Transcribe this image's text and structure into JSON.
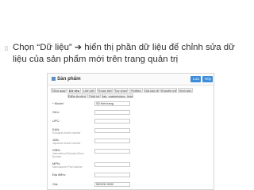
{
  "caption": {
    "part1": "Chọn “Dữ liệu” ",
    "arrow": "➔",
    "part2": " hiển thị phần dữ liệu để chỉnh sửa dữ liệu của sản phẩm mới trên trang quản trị"
  },
  "panel": {
    "title": "Sản phẩm",
    "save_label": "Lưu",
    "cancel_label": "Hủy"
  },
  "tabs": [
    {
      "label": "Tổng quan",
      "active": false
    },
    {
      "label": "Dữ liệu",
      "active": true
    },
    {
      "label": "Liên kết",
      "active": false
    },
    {
      "label": "Thuộc tính",
      "active": false
    },
    {
      "label": "Tùy chọn",
      "active": false
    },
    {
      "label": "Profiles",
      "active": false
    },
    {
      "label": "Giá bán lẻ",
      "active": false
    },
    {
      "label": "Khuyến mãi",
      "active": false
    },
    {
      "label": "Hình ảnh",
      "active": false
    },
    {
      "label": "Điểm thưởng",
      "active": false
    },
    {
      "label": "Thiết kế",
      "active": false
    },
    {
      "label": "tab_marketplace_links",
      "active": false
    }
  ],
  "fields": [
    {
      "label": "* Model:",
      "hint": "",
      "value": "Sổ thời trang"
    },
    {
      "label": "SKU:",
      "hint": "",
      "value": ""
    },
    {
      "label": "UPC:",
      "hint": "",
      "value": ""
    },
    {
      "label": "EAN:",
      "hint": "European Article Number",
      "value": ""
    },
    {
      "label": "JAN:",
      "hint": "Japanese Article Number",
      "value": ""
    },
    {
      "label": "ISBN:",
      "hint": "International Standard Book Number",
      "value": ""
    },
    {
      "label": "MPN:",
      "hint": "Manufacturer Part Number",
      "value": ""
    },
    {
      "label": "Địa điểm:",
      "hint": "",
      "value": ""
    },
    {
      "label": "Giá:",
      "hint": "",
      "value": "500000.0000"
    }
  ]
}
